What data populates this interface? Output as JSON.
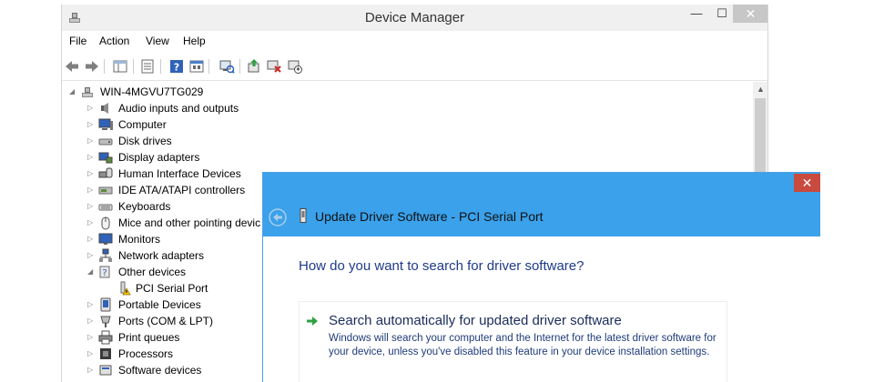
{
  "device_manager": {
    "title": "Device Manager",
    "window_buttons": {
      "minimize": "—",
      "maximize": "☐",
      "close": "✕"
    },
    "menu": [
      "File",
      "Action",
      "View",
      "Help"
    ],
    "toolbar_icons": [
      "back-arrow-icon",
      "forward-arrow-icon",
      "properties-view-icon",
      "list-view-icon",
      "help-icon",
      "show-hidden-icon",
      "scan-hardware-icon",
      "update-driver-icon",
      "uninstall-icon",
      "disable-device-icon"
    ],
    "tree": {
      "root": "WIN-4MGVU7TG029",
      "categories": [
        {
          "label": "Audio inputs and outputs",
          "icon": "speaker-icon",
          "expanded": false
        },
        {
          "label": "Computer",
          "icon": "computer-icon",
          "expanded": false
        },
        {
          "label": "Disk drives",
          "icon": "disk-drive-icon",
          "expanded": false
        },
        {
          "label": "Display adapters",
          "icon": "display-adapter-icon",
          "expanded": false
        },
        {
          "label": "Human Interface Devices",
          "icon": "hid-icon",
          "expanded": false
        },
        {
          "label": "IDE ATA/ATAPI controllers",
          "icon": "ide-controller-icon",
          "expanded": false
        },
        {
          "label": "Keyboards",
          "icon": "keyboard-icon",
          "expanded": false
        },
        {
          "label": "Mice and other pointing devic",
          "icon": "mouse-icon",
          "expanded": false
        },
        {
          "label": "Monitors",
          "icon": "monitor-icon",
          "expanded": false
        },
        {
          "label": "Network adapters",
          "icon": "network-adapter-icon",
          "expanded": false
        },
        {
          "label": "Other devices",
          "icon": "other-devices-icon",
          "expanded": true
        },
        {
          "label": "PCI Serial Port",
          "icon": "warning-device-icon",
          "child": true
        },
        {
          "label": "Portable Devices",
          "icon": "portable-device-icon",
          "expanded": false
        },
        {
          "label": "Ports (COM & LPT)",
          "icon": "port-icon",
          "expanded": false
        },
        {
          "label": "Print queues",
          "icon": "printer-icon",
          "expanded": false
        },
        {
          "label": "Processors",
          "icon": "processor-icon",
          "expanded": false
        },
        {
          "label": "Software devices",
          "icon": "software-device-icon",
          "expanded": false
        }
      ]
    }
  },
  "update_driver": {
    "title": "Update Driver Software - PCI Serial Port",
    "close": "✕",
    "question": "How do you want to search for driver software?",
    "option": {
      "title": "Search automatically for updated driver software",
      "description": "Windows will search your computer and the Internet for the latest driver software for your device, unless you've disabled this feature in your device installation settings."
    }
  },
  "colors": {
    "dialog_title_bar": "#3aa1ea",
    "dialog_close": "#c94a3e",
    "question_text": "#1e3a8a",
    "option_arrow": "#2ea043"
  }
}
